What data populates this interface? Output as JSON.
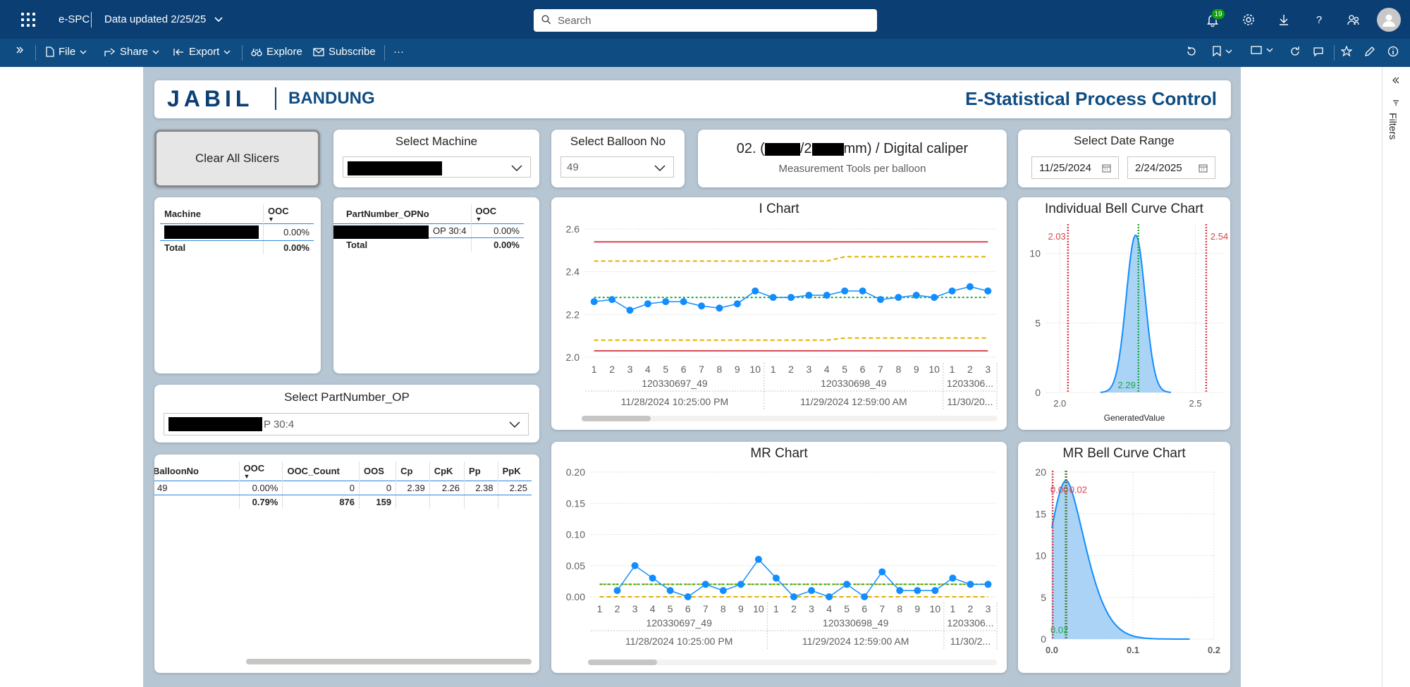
{
  "topbar": {
    "app_name": "e-SPC",
    "data_updated": "Data updated 2/25/25",
    "search_placeholder": "Search",
    "notification_count": "19"
  },
  "cmdbar": {
    "file": "File",
    "share": "Share",
    "export": "Export",
    "explore": "Explore",
    "subscribe": "Subscribe",
    "more": "···"
  },
  "right_pane": {
    "filters": "Filters"
  },
  "header": {
    "logo_text": "JABIL",
    "site": "BANDUNG",
    "title": "E-Statistical Process Control"
  },
  "clear_button": "Clear All Slicers",
  "select_machine": {
    "title": "Select Machine"
  },
  "select_balloon": {
    "title": "Select Balloon No",
    "value": "49"
  },
  "measurement": {
    "line1_prefix": "02. (",
    "line1_mid": "/2",
    "line1_suffix": "mm) / Digital caliper",
    "line2": "Measurement Tools per balloon"
  },
  "date_range": {
    "title": "Select Date Range",
    "start": "11/25/2024",
    "end": "2/24/2025"
  },
  "machine_table": {
    "headers": [
      "Machine",
      "OOC"
    ],
    "row": [
      "",
      "0.00%"
    ],
    "total": [
      "Total",
      "0.00%"
    ]
  },
  "partnumber_table": {
    "headers": [
      "PartNumber_OPNo",
      "OOC"
    ],
    "row": [
      "OP 30:4",
      "0.00%"
    ],
    "total": [
      "Total",
      "0.00%"
    ]
  },
  "select_partnumber": {
    "title": "Select PartNumber_OP",
    "value": "P 30:4"
  },
  "balloon_table": {
    "headers": [
      "BalloonNo",
      "OOC",
      "OOC_Count",
      "OOS",
      "Cp",
      "CpK",
      "Pp",
      "PpK"
    ],
    "row": [
      "49",
      "0.00%",
      "0",
      "0",
      "2.39",
      "2.26",
      "2.38",
      "2.25"
    ],
    "total": [
      "",
      "0.79%",
      "876",
      "159",
      "",
      "",
      "",
      ""
    ]
  },
  "i_chart": {
    "title": "I Chart"
  },
  "mr_chart": {
    "title": "MR Chart"
  },
  "ind_bell": {
    "title": "Individual Bell Curve Chart"
  },
  "mr_bell": {
    "title": "MR Bell Curve Chart"
  },
  "chart_data": [
    {
      "type": "line",
      "title": "I Chart",
      "x": [
        "1",
        "2",
        "3",
        "4",
        "5",
        "6",
        "7",
        "8",
        "9",
        "10",
        "1",
        "2",
        "3",
        "4",
        "5",
        "6",
        "7",
        "8",
        "9",
        "10",
        "1",
        "2",
        "3"
      ],
      "x_group_labels": [
        "120330697_49",
        "120330698_49",
        "1203306..."
      ],
      "x_date_labels": [
        "11/28/2024 10:25:00 PM",
        "11/29/2024 12:59:00 AM",
        "11/30/20..."
      ],
      "series": [
        {
          "values": [
            2.26,
            2.27,
            2.22,
            2.25,
            2.26,
            2.26,
            2.24,
            2.23,
            2.25,
            2.31,
            2.28,
            2.28,
            2.29,
            2.29,
            2.31,
            2.31,
            2.27,
            2.28,
            2.29,
            2.28,
            2.31,
            2.33,
            2.31
          ]
        }
      ],
      "limits": {
        "usl": 2.54,
        "lsl": 2.03,
        "ucl": [
          2.45,
          2.45,
          2.45,
          2.45,
          2.45,
          2.45,
          2.45,
          2.45,
          2.45,
          2.45,
          2.45,
          2.45,
          2.45,
          2.45,
          2.47,
          2.47,
          2.47,
          2.47,
          2.47,
          2.47,
          2.47,
          2.47,
          2.47
        ],
        "lcl": [
          2.08,
          2.08,
          2.08,
          2.08,
          2.08,
          2.08,
          2.08,
          2.08,
          2.08,
          2.08,
          2.08,
          2.08,
          2.08,
          2.08,
          2.09,
          2.09,
          2.09,
          2.09,
          2.09,
          2.09,
          2.09,
          2.09,
          2.09
        ],
        "center": 2.28
      },
      "ylim": [
        2.0,
        2.6
      ],
      "yticks": [
        "2.0",
        "2.2",
        "2.4",
        "2.6"
      ],
      "colors": {
        "series": "#118dff",
        "spec": "#d64550",
        "control": "#e0b000",
        "center": "#1aab40"
      }
    },
    {
      "type": "line",
      "title": "MR Chart",
      "x": [
        "1",
        "2",
        "3",
        "4",
        "5",
        "6",
        "7",
        "8",
        "9",
        "10",
        "1",
        "2",
        "3",
        "4",
        "5",
        "6",
        "7",
        "8",
        "9",
        "10",
        "1",
        "2",
        "3"
      ],
      "x_group_labels": [
        "120330697_49",
        "120330698_49",
        "1203306..."
      ],
      "x_date_labels": [
        "11/28/2024 10:25:00 PM",
        "11/29/2024 12:59:00 AM",
        "11/30/2..."
      ],
      "series": [
        {
          "values": [
            null,
            0.01,
            0.05,
            0.03,
            0.01,
            0.0,
            0.02,
            0.01,
            0.02,
            0.06,
            0.03,
            0.0,
            0.01,
            0.0,
            0.02,
            0.0,
            0.04,
            0.01,
            0.01,
            0.01,
            0.03,
            0.02,
            0.02
          ]
        }
      ],
      "limits": {
        "ucl": 0.02,
        "center": 0.02,
        "lcl": 0.0
      },
      "ylim": [
        0.0,
        0.2
      ],
      "yticks": [
        "0.00",
        "0.05",
        "0.10",
        "0.15",
        "0.20"
      ],
      "colors": {
        "series": "#118dff",
        "control": "#e0b000",
        "center": "#1aab40"
      }
    },
    {
      "type": "area",
      "title": "Individual Bell Curve Chart",
      "xlabel": "GeneratedValue",
      "xticks": [
        "2.0",
        "2.5"
      ],
      "yticks": [
        "0",
        "5",
        "10"
      ],
      "xlim": [
        1.95,
        2.6
      ],
      "ylim": [
        0,
        12
      ],
      "distribution": {
        "mean": 2.28,
        "sd": 0.035,
        "peak": 11.3
      },
      "annotations": {
        "lsl": "2.03",
        "usl": "2.54",
        "mean": "2.29"
      },
      "colors": {
        "fill": "#9ccbf5",
        "line": "#118dff",
        "spec": "#d64550",
        "mean": "#1aab40"
      }
    },
    {
      "type": "area",
      "title": "MR Bell Curve Chart",
      "xticks": [
        "0.0",
        "0.1",
        "0.2"
      ],
      "yticks": [
        "0",
        "5",
        "10",
        "15",
        "20"
      ],
      "xlim": [
        0.0,
        0.2
      ],
      "ylim": [
        0,
        20
      ],
      "distribution": {
        "peak": 19,
        "peak_at": 0.018
      },
      "annotations": {
        "left": "0.00",
        "right": "0.02",
        "mean": "0.02"
      },
      "colors": {
        "fill": "#9ccbf5",
        "line": "#118dff",
        "spec": "#d64550",
        "mean": "#1aab40"
      }
    }
  ]
}
